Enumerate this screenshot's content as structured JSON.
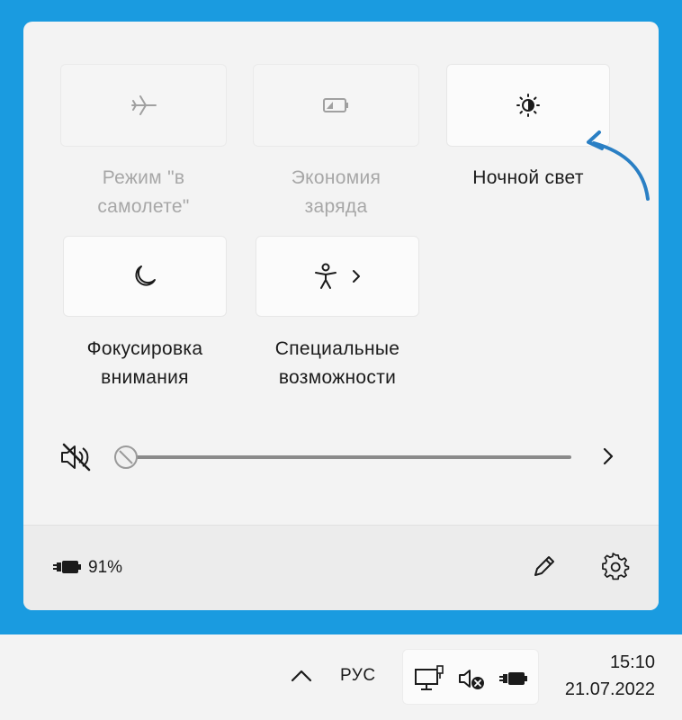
{
  "quick_settings": {
    "tiles": [
      {
        "label": "Режим \"в\nсамолете\"",
        "icon": "airplane-icon",
        "state": "disabled"
      },
      {
        "label": "Экономия\nзаряда",
        "icon": "battery-saver-icon",
        "state": "disabled"
      },
      {
        "label": "Ночной свет",
        "icon": "night-light-icon",
        "state": "off"
      },
      {
        "label": "Фокусировка\nвнимания",
        "icon": "moon-icon",
        "state": "off"
      },
      {
        "label": "Специальные\nвозможности",
        "icon": "accessibility-icon",
        "state": "off"
      }
    ],
    "volume": {
      "level": 0,
      "muted": true
    }
  },
  "footer": {
    "battery_percent": "91%"
  },
  "taskbar": {
    "language": "РУС",
    "time": "15:10",
    "date": "21.07.2022"
  },
  "colors": {
    "desktop_background": "#1a9be0",
    "annotation_arrow": "#2a7fc4"
  }
}
